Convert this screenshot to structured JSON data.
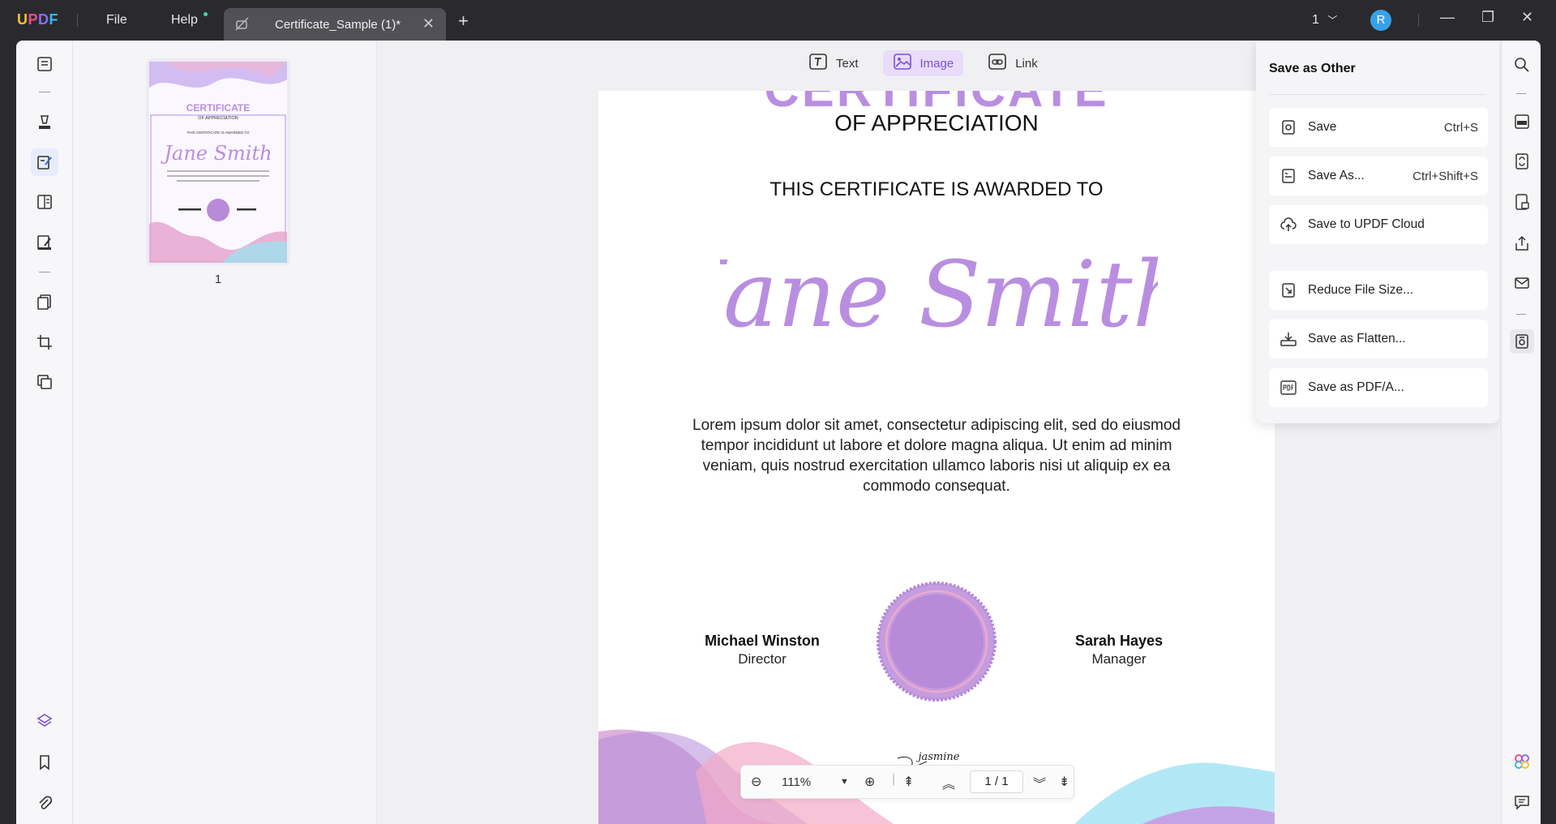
{
  "app": {
    "logo": [
      "U",
      "P",
      "D",
      "F"
    ],
    "menu": {
      "file": "File",
      "help": "Help"
    }
  },
  "tab": {
    "title": "Certificate_Sample (1)*"
  },
  "header": {
    "page_count": "1"
  },
  "user": {
    "avatar_letter": "R"
  },
  "thumbnails": {
    "page_number": "1"
  },
  "edit_toolbar": {
    "text": "Text",
    "image": "Image",
    "link": "Link"
  },
  "certificate": {
    "heading": "CERTIFICATE",
    "subheading": "OF APPRECIATION",
    "awarded": "THIS CERTIFICATE IS AWARDED TO",
    "recipient": "Jane Smith",
    "body": "Lorem ipsum dolor sit amet, consectetur adipiscing elit, sed do eiusmod tempor incididunt ut labore et dolore magna aliqua. Ut enim ad minim veniam, quis nostrud exercitation ullamco laboris nisi ut aliquip ex ea commodo consequat.",
    "signer_left": {
      "name": "Michael Winston",
      "role": "Director"
    },
    "signer_right": {
      "name": "Sarah Hayes",
      "role": "Manager"
    },
    "signature": "jasmine"
  },
  "bottom_nav": {
    "zoom": "111%",
    "current_page": "1",
    "total_pages": "1"
  },
  "save_panel": {
    "title": "Save as Other",
    "items": [
      {
        "label": "Save",
        "shortcut": "Ctrl+S"
      },
      {
        "label": "Save As...",
        "shortcut": "Ctrl+Shift+S"
      },
      {
        "label": "Save to UPDF Cloud",
        "shortcut": ""
      },
      {
        "label": "Reduce File Size...",
        "shortcut": ""
      },
      {
        "label": "Save as Flatten...",
        "shortcut": ""
      },
      {
        "label": "Save as PDF/A...",
        "shortcut": ""
      }
    ]
  },
  "colors": {
    "accent": "#7a4fd8",
    "certificate_purple": "#b98ee0",
    "seal": "#b88ad8",
    "avatar": "#3aa0e6"
  }
}
